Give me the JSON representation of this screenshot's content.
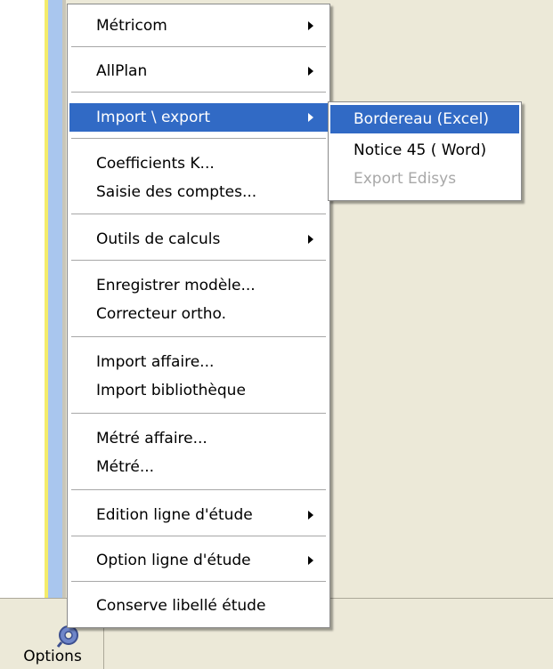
{
  "menu": {
    "items": [
      {
        "label": "Métricom",
        "submenu": true
      },
      {
        "label": "AllPlan",
        "submenu": true
      },
      {
        "label": "Import \\ export",
        "submenu": true,
        "highlighted": true
      },
      {
        "label": "Coefficients K..."
      },
      {
        "label": "Saisie des comptes..."
      },
      {
        "label": "Outils de calculs",
        "submenu": true
      },
      {
        "label": "Enregistrer modèle..."
      },
      {
        "label": "Correcteur ortho."
      },
      {
        "label": "Import affaire..."
      },
      {
        "label": "Import bibliothèque"
      },
      {
        "label": "Métré affaire..."
      },
      {
        "label": "Métré..."
      },
      {
        "label": "Edition ligne d'étude",
        "submenu": true
      },
      {
        "label": "Option ligne d'étude",
        "submenu": true
      },
      {
        "label": "Conserve libellé étude"
      }
    ]
  },
  "submenu": {
    "items": [
      {
        "label": "Bordereau (Excel)",
        "highlighted": true
      },
      {
        "label": "Notice 45 ( Word)"
      },
      {
        "label": "Export Edisys",
        "disabled": true
      }
    ]
  },
  "toolbar": {
    "options_label": "Options",
    "options_icon": "options-gear-icon"
  },
  "colors": {
    "highlight": "#316ac5",
    "background": "#ece9d8",
    "disabled_text": "#a8a8a8"
  }
}
